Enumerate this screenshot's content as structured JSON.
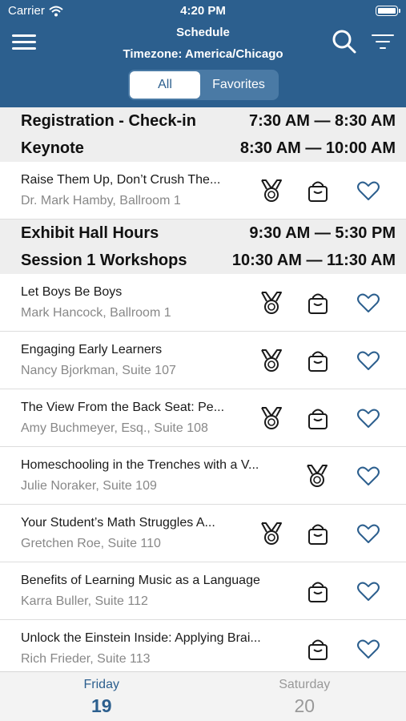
{
  "status_bar": {
    "carrier": "Carrier",
    "time": "4:20 PM"
  },
  "header": {
    "title": "Schedule",
    "subtitle": "Timezone: America/Chicago",
    "segments": [
      {
        "label": "All"
      },
      {
        "label": "Favorites"
      }
    ],
    "active_segment": "All"
  },
  "blocks": [
    {
      "label": "Registration - Check-in",
      "time": "7:30 AM — 8:30 AM"
    },
    {
      "label": "Keynote",
      "time": "8:30 AM — 10:00 AM"
    },
    {
      "label": "Exhibit Hall Hours",
      "time": "9:30 AM — 5:30 PM"
    },
    {
      "label": "Session 1 Workshops",
      "time": "10:30 AM — 11:30 AM"
    }
  ],
  "sessions": [
    {
      "title": "Raise Them Up, Don’t Crush The...",
      "subtitle": "Dr. Mark Hamby, Ballroom 1",
      "icons": [
        "medal-icon",
        "bag-icon",
        "heart-icon"
      ]
    },
    {
      "title": "Let Boys Be Boys",
      "subtitle": "Mark Hancock, Ballroom 1",
      "icons": [
        "medal-icon",
        "bag-icon",
        "heart-icon"
      ]
    },
    {
      "title": "Engaging Early Learners",
      "subtitle": "Nancy Bjorkman, Suite 107",
      "icons": [
        "medal-icon",
        "bag-icon",
        "heart-icon"
      ]
    },
    {
      "title": "The View From the Back Seat: Pe...",
      "subtitle": "Amy Buchmeyer, Esq., Suite 108",
      "icons": [
        "medal-icon",
        "bag-icon",
        "heart-icon"
      ]
    },
    {
      "title": "Homeschooling in the Trenches with a V...",
      "subtitle": "Julie Noraker, Suite 109",
      "icons": [
        "medal-icon",
        "heart-icon"
      ]
    },
    {
      "title": "Your Student’s Math Struggles A...",
      "subtitle": "Gretchen Roe, Suite 110",
      "icons": [
        "medal-icon",
        "bag-icon",
        "heart-icon"
      ]
    },
    {
      "title": "Benefits of Learning Music as a Language",
      "subtitle": "Karra Buller, Suite 112",
      "icons": [
        "bag-icon",
        "heart-icon"
      ]
    },
    {
      "title": "Unlock the Einstein Inside: Applying Brai...",
      "subtitle": "Rich Frieder, Suite 113",
      "icons": [
        "bag-icon",
        "heart-icon"
      ]
    }
  ],
  "day_tabs": [
    {
      "name": "Friday",
      "date": "19",
      "active": true
    },
    {
      "name": "Saturday",
      "date": "20",
      "active": false
    }
  ],
  "colors": {
    "brand": "#2c5f8e",
    "heart": "#2c5f8e",
    "muted": "#888888",
    "section_bg": "#eeeeee"
  }
}
